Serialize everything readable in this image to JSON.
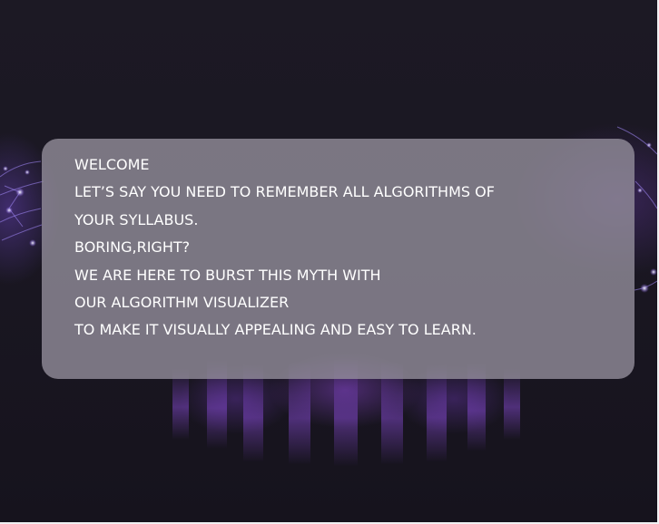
{
  "card": {
    "lines": [
      "WELCOME",
      "LET’S SAY YOU NEED TO REMEMBER ALL ALGORITHMS OF",
      "YOUR SYLLABUS.",
      "BORING,RIGHT?",
      "WE ARE HERE TO BURST THIS MYTH WITH",
      "OUR ALGORITHM VISUALIZER",
      "TO MAKE IT VISUALLY APPEALING AND EASY TO LEARN."
    ]
  },
  "colors": {
    "background": "#1a1722",
    "accent_glow": "#8c46d2",
    "card_background": "#96919e",
    "text": "#ffffff"
  }
}
